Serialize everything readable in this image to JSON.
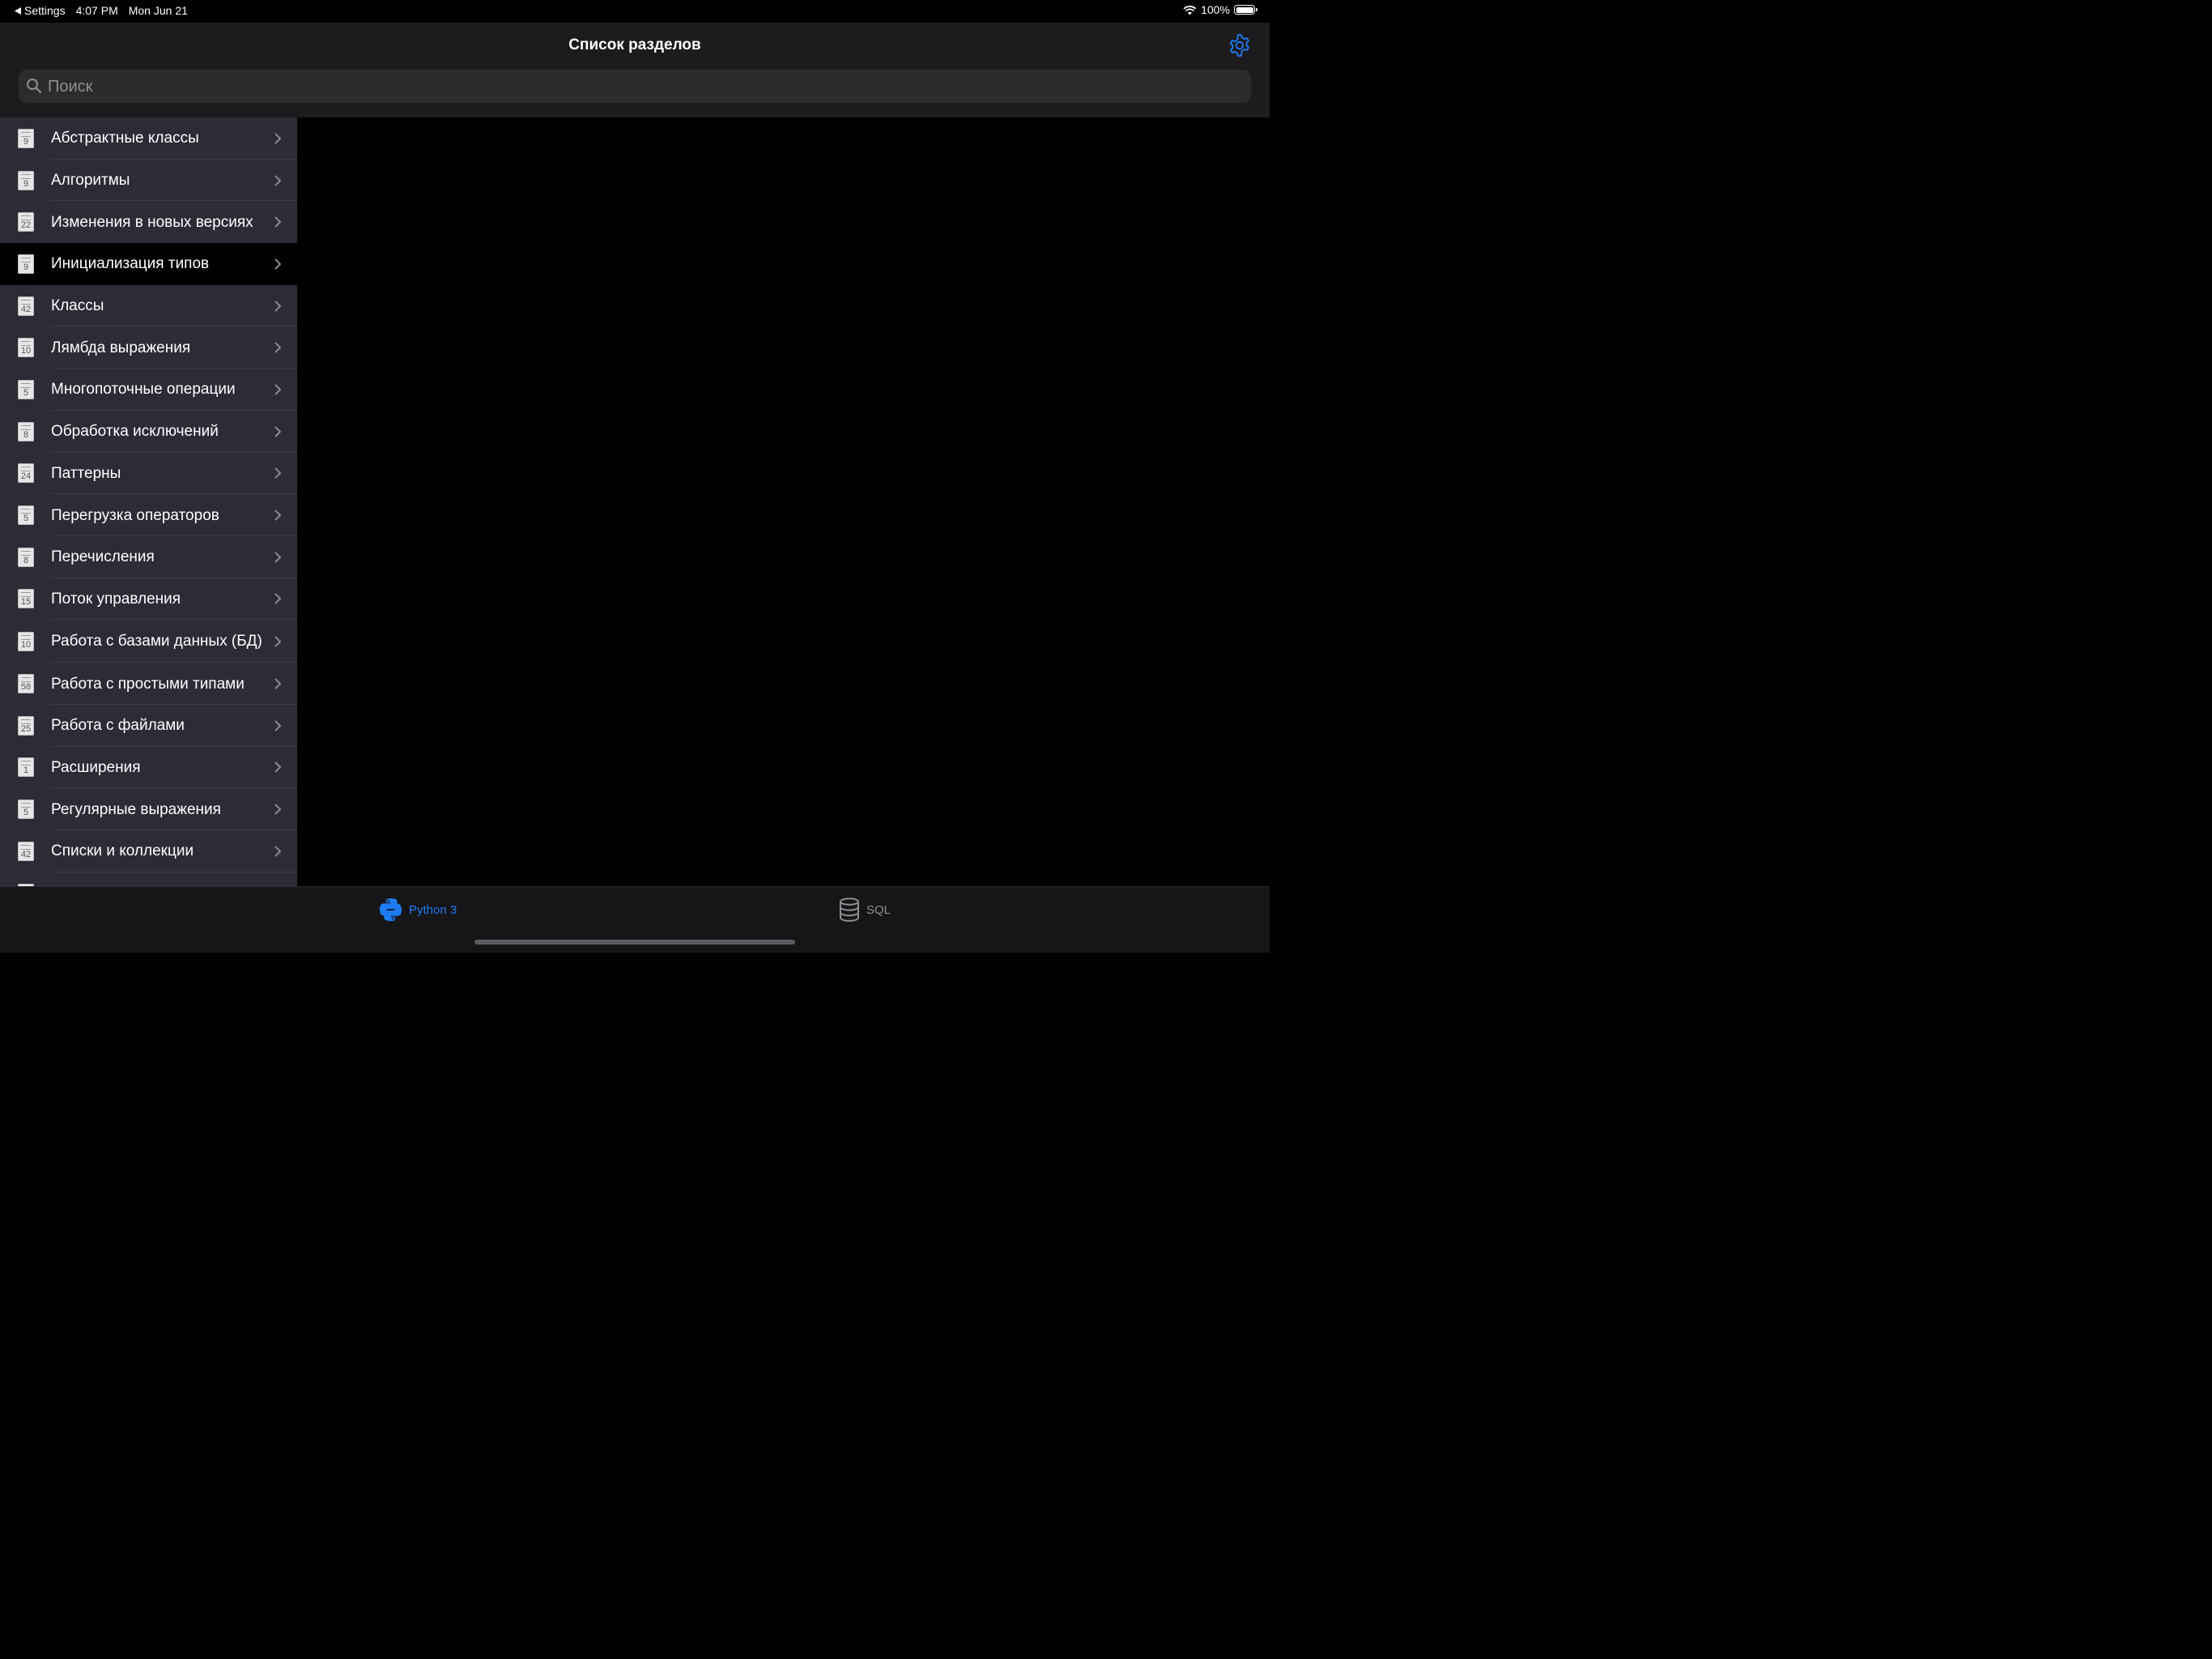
{
  "status_bar": {
    "back_app": "Settings",
    "time": "4:07 PM",
    "date": "Mon Jun 21",
    "battery": "100%"
  },
  "navbar": {
    "title": "Список разделов",
    "settings_icon": "gear-icon"
  },
  "search": {
    "placeholder": "Поиск",
    "value": ""
  },
  "sections": [
    {
      "label": "Абстрактные классы",
      "count": "9"
    },
    {
      "label": "Алгоритмы",
      "count": "9"
    },
    {
      "label": "Изменения в новых версиях",
      "count": "22"
    },
    {
      "label": "Инициализация типов",
      "count": "9",
      "selected": true
    },
    {
      "label": "Классы",
      "count": "42"
    },
    {
      "label": "Лямбда выражения",
      "count": "10"
    },
    {
      "label": "Многопоточные операции",
      "count": "5"
    },
    {
      "label": "Обработка исключений",
      "count": "8"
    },
    {
      "label": "Паттерны",
      "count": "24"
    },
    {
      "label": "Перегрузка операторов",
      "count": "5"
    },
    {
      "label": "Перечисления",
      "count": "8"
    },
    {
      "label": "Поток управления",
      "count": "15"
    },
    {
      "label": "Работа с базами данных (БД)",
      "count": "10"
    },
    {
      "label": "Работа с простыми типами",
      "count": "58"
    },
    {
      "label": "Работа с файлами",
      "count": "25"
    },
    {
      "label": "Расширения",
      "count": "1"
    },
    {
      "label": "Регулярные выражения",
      "count": "5"
    },
    {
      "label": "Списки и коллекции",
      "count": "42"
    },
    {
      "label": "",
      "count": ""
    }
  ],
  "tabs": [
    {
      "label": "Python 3",
      "icon": "python-icon",
      "active": true
    },
    {
      "label": "SQL",
      "icon": "database-icon",
      "active": false
    }
  ],
  "colors": {
    "accent": "#1e7cf2",
    "sidebar_bg": "#2c2c36",
    "selected_row": "#000000"
  }
}
